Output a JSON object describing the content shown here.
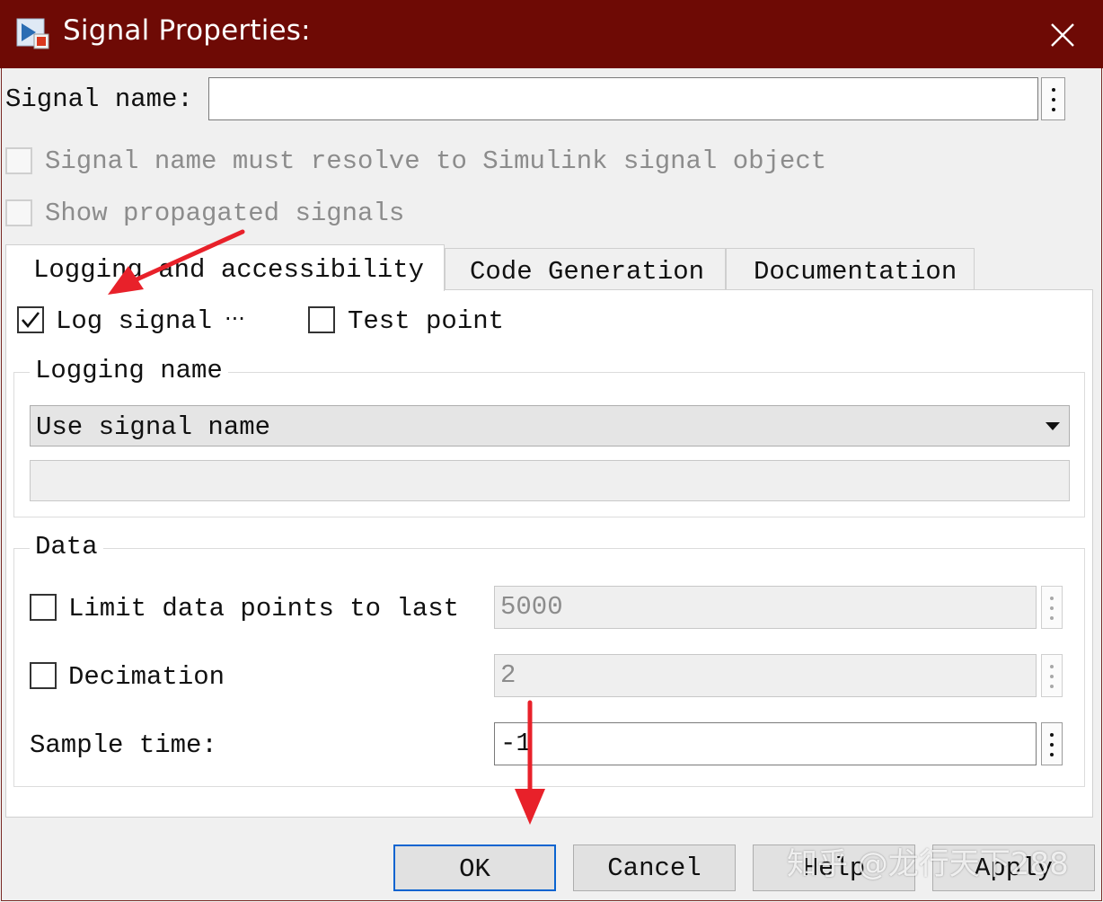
{
  "window": {
    "title": "Signal Properties:"
  },
  "signal_name": {
    "label": "Signal name:",
    "value": ""
  },
  "options": {
    "resolve_label": "Signal name must resolve to Simulink signal object",
    "resolve_checked": false,
    "propagated_label": "Show propagated signals",
    "propagated_checked": false
  },
  "tabs": [
    {
      "label": "Logging and accessibility",
      "active": true
    },
    {
      "label": "Code Generation",
      "active": false
    },
    {
      "label": "Documentation",
      "active": false
    }
  ],
  "logging": {
    "log_signal_label": "Log signal",
    "log_signal_checked": true,
    "log_signal_more": "···",
    "test_point_label": "Test point",
    "test_point_checked": false,
    "logging_name_legend": "Logging name",
    "logging_name_selected": "Use signal name",
    "logging_name_custom": ""
  },
  "data": {
    "legend": "Data",
    "limit_label": "Limit data points to last",
    "limit_checked": false,
    "limit_value": "5000",
    "decimation_label": "Decimation",
    "decimation_checked": false,
    "decimation_value": "2",
    "sample_time_label": "Sample time:",
    "sample_time_value": "-1"
  },
  "buttons": {
    "ok": "OK",
    "cancel": "Cancel",
    "help": "Help",
    "apply": "Apply"
  },
  "watermark": "知乎 @龙行天下288",
  "colors": {
    "titlebar": "#6e0a05",
    "annotation_arrow": "#e8212a",
    "default_button_border": "#0a64d0"
  }
}
